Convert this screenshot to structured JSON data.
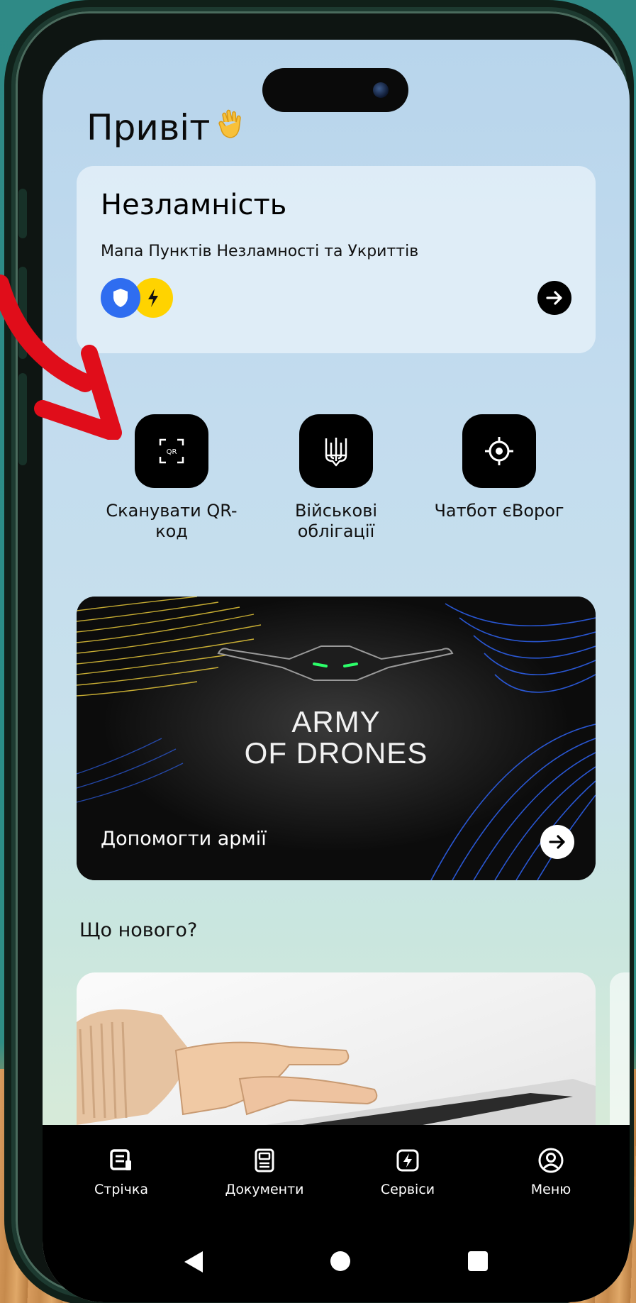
{
  "greeting": "Привіт",
  "nezlamnist_card": {
    "title": "Незламність",
    "subtitle": "Мапа Пунктів Незламності та Укриттів"
  },
  "quick_actions": [
    {
      "label": "Сканувати QR-код",
      "icon": "qr-scan-icon"
    },
    {
      "label": "Військові облігації",
      "icon": "trident-icon"
    },
    {
      "label": "Чатбот єВорог",
      "icon": "target-icon"
    }
  ],
  "drones_banner": {
    "logo_line1": "ARMY",
    "logo_line2": "OF DRONES",
    "cta": "Допомогти армії"
  },
  "whats_new": "Що нового?",
  "tabbar": [
    {
      "label": "Стрічка",
      "icon": "feed-icon"
    },
    {
      "label": "Документи",
      "icon": "documents-icon"
    },
    {
      "label": "Сервіси",
      "icon": "services-icon"
    },
    {
      "label": "Меню",
      "icon": "profile-icon"
    }
  ],
  "colors": {
    "accent_red": "#e00d1a",
    "shield_blue": "#2f6df0",
    "bolt_yellow": "#ffd300",
    "ua_blue": "#2d5fe8",
    "ua_yellow": "#e8c93a"
  }
}
